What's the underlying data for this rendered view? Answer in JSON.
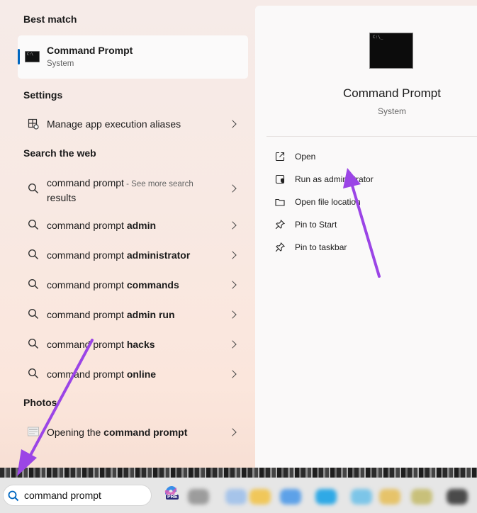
{
  "best_match": {
    "heading": "Best match",
    "title": "Command Prompt",
    "subtitle": "System"
  },
  "settings": {
    "heading": "Settings",
    "items": [
      {
        "label": "Manage app execution aliases",
        "icon": "app-settings-icon"
      }
    ]
  },
  "web": {
    "heading": "Search the web",
    "first": {
      "prefix": "command prompt",
      "more": " - See more search",
      "more2": "results"
    },
    "items": [
      {
        "prefix": "command prompt ",
        "bold": "admin"
      },
      {
        "prefix": "command prompt ",
        "bold": "administrator"
      },
      {
        "prefix": "command prompt ",
        "bold": "commands"
      },
      {
        "prefix": "command prompt ",
        "bold": "admin run"
      },
      {
        "prefix": "command prompt ",
        "bold": "hacks"
      },
      {
        "prefix": "command prompt ",
        "bold": "online"
      }
    ]
  },
  "photos": {
    "heading": "Photos",
    "item": {
      "prefix": "Opening the ",
      "bold": "command prompt"
    }
  },
  "detail": {
    "title": "Command Prompt",
    "subtitle": "System",
    "actions": [
      {
        "label": "Open",
        "icon": "open-external-icon"
      },
      {
        "label": "Run as administrator",
        "icon": "shield-icon"
      },
      {
        "label": "Open file location",
        "icon": "folder-icon"
      },
      {
        "label": "Pin to Start",
        "icon": "pin-icon"
      },
      {
        "label": "Pin to taskbar",
        "icon": "pin-icon"
      }
    ]
  },
  "taskbar": {
    "search_value": "command prompt",
    "copilot_badge": "PRE"
  },
  "colors": {
    "accent": "#0067c0",
    "arrow": "#9b45e6"
  }
}
